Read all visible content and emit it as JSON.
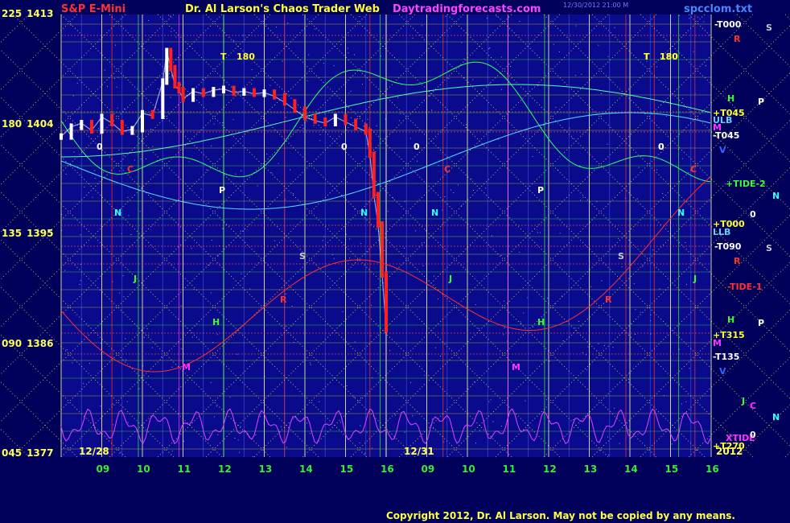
{
  "header": {
    "symbol": "S&P E-Mini",
    "title": "Dr. Al Larson's Chaos Trader Web",
    "site": "Daytradingforecasts.com",
    "file": "spcclom.txt",
    "stamp": "12/30/2012 21:00 M"
  },
  "copyright": "Copyright 2012, Dr. Al Larson. May not be copied by any means.",
  "colors": {
    "background": "#00005a",
    "plot_bg": "#0a0a8c",
    "price_up": "#ffffff",
    "price_down": "#ff2020",
    "title_red": "#ff3030",
    "title_yellow": "#ffff33",
    "site_magenta": "#ff44ff",
    "axis_yellow": "#ffff55",
    "axis_green": "#33ee33"
  },
  "chart_data": {
    "type": "line",
    "title": "S&P E-Mini",
    "y_ticks": [
      {
        "angle": "225",
        "price": "1413",
        "value": 1413
      },
      {
        "angle": "180",
        "price": "1404",
        "value": 1404
      },
      {
        "angle": "135",
        "price": "1395",
        "value": 1395
      },
      {
        "angle": "090",
        "price": "1386",
        "value": 1386
      },
      {
        "angle": "045",
        "price": "1377",
        "value": 1377
      }
    ],
    "ylim": [
      1377,
      1413
    ],
    "x_ticks": [
      "09",
      "10",
      "11",
      "12",
      "13",
      "14",
      "15",
      "16",
      "09",
      "10",
      "11",
      "12",
      "13",
      "14",
      "15",
      "16"
    ],
    "date_labels": [
      "12/28",
      "12/31",
      "2012"
    ],
    "price_series": {
      "name": "S&P E-Mini",
      "x_hours": [
        8.0,
        8.25,
        8.5,
        8.75,
        9.0,
        9.25,
        9.5,
        9.75,
        10.0,
        10.25,
        10.5,
        10.6,
        10.7,
        10.8,
        10.9,
        11.0,
        11.25,
        11.5,
        11.75,
        12.0,
        12.25,
        12.5,
        12.75,
        13.0,
        13.25,
        13.5,
        13.75,
        14.0,
        14.25,
        14.5,
        14.75,
        15.0,
        15.25,
        15.5,
        15.6,
        15.7,
        15.8,
        15.9,
        16.0
      ],
      "prices": [
        1403.0,
        1403.8,
        1404.1,
        1403.5,
        1404.6,
        1404.1,
        1403.4,
        1403.6,
        1404.9,
        1404.7,
        1407.5,
        1410.0,
        1408.6,
        1407.2,
        1406.8,
        1406.1,
        1406.7,
        1406.5,
        1406.8,
        1406.9,
        1406.6,
        1406.7,
        1406.5,
        1406.6,
        1406.3,
        1405.8,
        1405.2,
        1404.6,
        1404.3,
        1404.1,
        1404.6,
        1404.2,
        1403.8,
        1403.4,
        1401.5,
        1398.2,
        1395.8,
        1391.7,
        1387.2
      ]
    },
    "right_labels": [
      {
        "text": "-T000",
        "color": "#ffffff"
      },
      {
        "text": "R",
        "color": "#ff3030"
      },
      {
        "text": "S",
        "color": "#c8c8c8"
      },
      {
        "text": "T",
        "color": "#ffff33"
      },
      {
        "text": "180",
        "color": "#ffff33"
      },
      {
        "text": "H",
        "color": "#33ff33"
      },
      {
        "text": "P",
        "color": "#ffffff"
      },
      {
        "text": "+T045",
        "color": "#ffff33"
      },
      {
        "text": "ULB",
        "color": "#66ccff"
      },
      {
        "text": "M",
        "color": "#ff33ff"
      },
      {
        "text": "-T045",
        "color": "#ffffff"
      },
      {
        "text": "V",
        "color": "#3366ff"
      },
      {
        "text": "0",
        "color": "#ffffff"
      },
      {
        "text": "+TIDE-2",
        "color": "#33ff33"
      },
      {
        "text": "N",
        "color": "#33ffff"
      },
      {
        "text": "0",
        "color": "#ffffff"
      },
      {
        "text": "+T000",
        "color": "#ffff33"
      },
      {
        "text": "LLB",
        "color": "#66ccff"
      },
      {
        "text": "-T090",
        "color": "#ffffff"
      },
      {
        "text": "S",
        "color": "#c8c8c8"
      },
      {
        "text": "R",
        "color": "#ff3030"
      },
      {
        "text": "-TIDE-1",
        "color": "#ff3030"
      },
      {
        "text": "H",
        "color": "#33ff33"
      },
      {
        "text": "P",
        "color": "#ffffff"
      },
      {
        "text": "+T315",
        "color": "#ffff33"
      },
      {
        "text": "M",
        "color": "#ff33ff"
      },
      {
        "text": "-T135",
        "color": "#ffffff"
      },
      {
        "text": "V",
        "color": "#3366ff"
      },
      {
        "text": "J",
        "color": "#33ff33"
      },
      {
        "text": "C",
        "color": "#ff33ff"
      },
      {
        "text": "N",
        "color": "#33ffff"
      },
      {
        "text": "XTIDE",
        "color": "#ff33ff"
      },
      {
        "text": "0",
        "color": "#ffffff"
      },
      {
        "text": "+T270",
        "color": "#ffff33"
      }
    ],
    "plot_letters": [
      {
        "text": "T",
        "color": "#ffff33"
      },
      {
        "text": "180",
        "color": "#ffff33"
      },
      {
        "text": "0",
        "color": "#ffffff"
      },
      {
        "text": "C",
        "color": "#ff3030"
      },
      {
        "text": "P",
        "color": "#ffffff"
      },
      {
        "text": "N",
        "color": "#33ffff"
      },
      {
        "text": "J",
        "color": "#33ff33"
      },
      {
        "text": "H",
        "color": "#33ff33"
      },
      {
        "text": "M",
        "color": "#ff33ff"
      },
      {
        "text": "S",
        "color": "#c8c8c8"
      },
      {
        "text": "R",
        "color": "#ff3030"
      },
      {
        "text": "0",
        "color": "#ffffff"
      },
      {
        "text": "N",
        "color": "#33ffff"
      },
      {
        "text": "0",
        "color": "#ffffff"
      },
      {
        "text": "C",
        "color": "#ff3030"
      },
      {
        "text": "N",
        "color": "#33ffff"
      },
      {
        "text": "J",
        "color": "#33ff33"
      },
      {
        "text": "P",
        "color": "#ffffff"
      },
      {
        "text": "H",
        "color": "#33ff33"
      },
      {
        "text": "M",
        "color": "#ff33ff"
      },
      {
        "text": "S",
        "color": "#c8c8c8"
      },
      {
        "text": "R",
        "color": "#ff3030"
      },
      {
        "text": "0",
        "color": "#ffffff"
      },
      {
        "text": "C",
        "color": "#ff3030"
      },
      {
        "text": "N",
        "color": "#33ffff"
      },
      {
        "text": "J",
        "color": "#33ff33"
      },
      {
        "text": "T",
        "color": "#ffff33"
      },
      {
        "text": "180",
        "color": "#ffff33"
      }
    ]
  }
}
